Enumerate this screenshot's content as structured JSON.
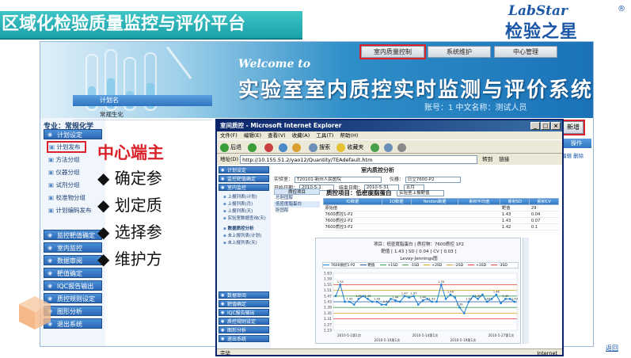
{
  "slide": {
    "title": "区域化检验质量监控与评价平台",
    "logo_top": "LabStar",
    "logo_bottom": "检验之星",
    "logo_reg": "®",
    "back_link": "返回"
  },
  "banner": {
    "welcome_line1": "Welcome to",
    "title": "实验室室内质控实时监测与评价系统",
    "user_info": "账号：1   中文名称：测试人员",
    "nav": [
      "室内质量控制",
      "系统维护",
      "中心管理"
    ]
  },
  "sidebar": {
    "specialty": "专业：常规化学",
    "groups_top": [
      {
        "label": "计划设定",
        "items": [
          "计划发布",
          "方法分组",
          "仪器分组",
          "试剂分组",
          "校准物分组",
          "计划编码发布"
        ]
      }
    ],
    "groups_bottom": [
      "监控靶值确定",
      "室内监控",
      "数据审阅",
      "靶值确定",
      "IQC报告输出",
      "质控规则设定",
      "图形分析",
      "退出系统"
    ]
  },
  "content": {
    "plan_header": "计划名",
    "plan_row": "常规生化",
    "center_heading": "中心端主",
    "bullets": [
      "◆ 确定参",
      "◆ 划定质",
      "◆ 选择参",
      "◆ 维护方"
    ],
    "add_button": "新增",
    "op_header": "操作",
    "op_links": "编辑  删除"
  },
  "ie": {
    "title": "室间质控 - Microsoft Internet Explorer",
    "menu": [
      "文件(F)",
      "编辑(E)",
      "查看(V)",
      "收藏(A)",
      "工具(T)",
      "帮助(H)"
    ],
    "toolbar": [
      "后退",
      "搜索",
      "收藏夹"
    ],
    "address_label": "地址(D)",
    "url": "http://10.155.51.2/yao12/Quantity/TEAdefault.htm",
    "go": "转到",
    "links": "链接",
    "status": "完毕",
    "zone": "Internet",
    "nav_groups": [
      "计划设定",
      "监控靶值确定",
      "室内监控"
    ],
    "nav_items": [
      "上报列表(计划)",
      "上报列表(月)",
      "上报列表(天)",
      "实验室数据查询(天)",
      "数据质控分析",
      "未上报列表(计划)",
      "未上报列表(天)"
    ],
    "nav_bottom": [
      "数据审阅",
      "靶值确定",
      "IQC报告输出",
      "质控规则设定",
      "图形分析",
      "退出系统"
    ],
    "form": {
      "page_title": "室内质控分析",
      "lab_label": "实验室：",
      "lab_value": "T20101-新州人民医院",
      "instrument_label": "仪器：",
      "instrument_value": "日立7600-P2",
      "start_label": "开始日期：",
      "start_value": "2010-5-1",
      "end_label": "结束日期：",
      "end_value": "2010-5-31",
      "period_value": "五月"
    },
    "project": {
      "header": "质控项目",
      "items": [
        "总胆固醇",
        "低密度脂蛋白",
        "胆固醇"
      ]
    },
    "qc_title": "质控项目：低密度脂蛋白",
    "qc_select": "实验室上报靶值",
    "table_headers": [
      "IQ数据",
      "1Q数据",
      "Yenden数据",
      "累积平均值",
      "累积SD",
      "累积CV"
    ],
    "table_rows": [
      [
        "原始值",
        "",
        "",
        "",
        "靶值",
        "29"
      ],
      [
        "7600质控1-P2",
        "",
        "",
        "",
        "1.43",
        "0.04"
      ],
      [
        "7600质控2-P2",
        "",
        "",
        "",
        "1.43",
        "0.07"
      ],
      [
        "7600质控3-P2",
        "",
        "",
        "",
        "1.42",
        "0.1"
      ]
    ]
  },
  "chart_data": {
    "type": "line",
    "title": "项目：低密度脂蛋白 | 质控物：7600质控 1P2",
    "subtitle": "靶值 [ 1.43 ] SD [ 0.04 ] CV [ 0.03 ]",
    "chart_name": "Levey-Jennings图",
    "legend": [
      "7600质控1-P2",
      "靶值",
      "+1SD",
      "-1SD",
      "+2SD",
      "-2SD",
      "+3SD",
      "-3SD"
    ],
    "y_ticks": [
      "1.63",
      "1.59",
      "1.55",
      "1.51",
      "1.47",
      "1.43",
      "1.39",
      "1.35",
      "1.31",
      "1.27",
      "1.23"
    ],
    "ylim": [
      1.23,
      1.63
    ],
    "x_labels": [
      "2010-5-1第1次",
      "2010-5-10第1次",
      "2010-5-14第1次",
      "2010-5-19第1次",
      "2010-5-27第1次"
    ],
    "series": [
      {
        "name": "7600质控1-P2",
        "values": [
          1.47,
          1.55,
          1.43,
          1.43,
          1.41,
          1.45,
          1.47,
          1.45,
          1.43,
          1.43,
          1.41,
          1.41,
          1.45,
          1.44,
          1.43,
          1.47,
          1.46,
          1.47,
          1.41,
          1.44,
          1.45,
          1.43,
          1.43,
          1.55,
          1.45,
          1.48,
          1.46,
          1.39,
          1.35,
          1.43,
          1.47,
          1.45,
          1.48,
          1.43,
          1.45,
          1.48,
          1.42,
          1.45,
          1.45,
          1.43
        ]
      }
    ],
    "reference_lines": [
      {
        "name": "+3SD",
        "value": 1.55,
        "color": "#e14040"
      },
      {
        "name": "+2SD",
        "value": 1.51,
        "color": "#e5a020"
      },
      {
        "name": "+1SD",
        "value": 1.47,
        "color": "#3aa04a"
      },
      {
        "name": "靶值",
        "value": 1.43,
        "color": "#1b57a6"
      },
      {
        "name": "-1SD",
        "value": 1.39,
        "color": "#3aa04a"
      },
      {
        "name": "-2SD",
        "value": 1.35,
        "color": "#e5a020"
      },
      {
        "name": "-3SD",
        "value": 1.31,
        "color": "#e14040"
      }
    ],
    "line_color": "#1f7fd0",
    "grid": true
  }
}
